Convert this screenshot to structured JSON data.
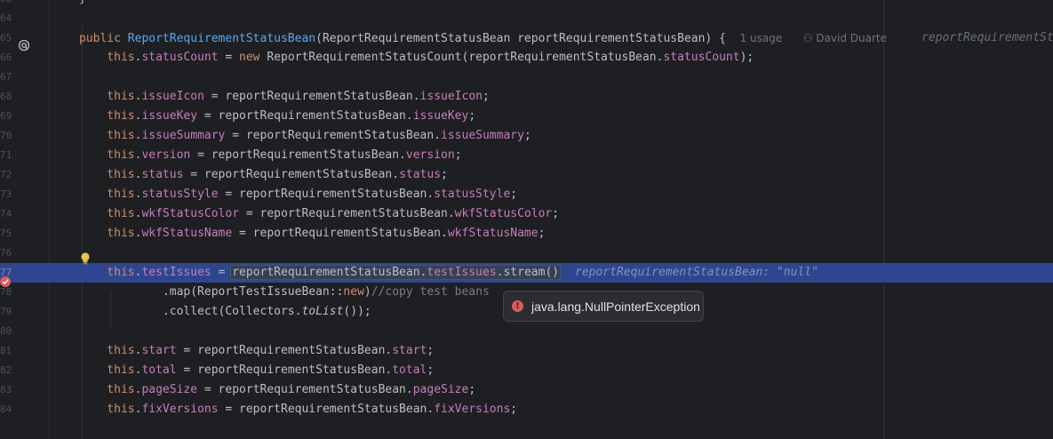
{
  "editor": {
    "lines": [
      {
        "num": "63",
        "segs": [
          {
            "t": "}",
            "c": "plain"
          }
        ]
      },
      {
        "num": "64",
        "segs": []
      },
      {
        "num": "65",
        "segs": [
          {
            "t": "public ",
            "c": "kw"
          },
          {
            "t": "ReportRequirementStatusBean",
            "c": "fn"
          },
          {
            "t": "(ReportRequirementStatusBean reportRequirementStatusBean) {  ",
            "c": "plain"
          },
          {
            "t": "1 usage",
            "c": "hint"
          },
          {
            "t": "   ",
            "c": "plain"
          },
          {
            "t": "⚇ David Duarte",
            "c": "hint"
          }
        ],
        "far_hint": "reportRequirementSt"
      },
      {
        "num": "66",
        "segs": [
          {
            "t": "    this",
            "c": "kw"
          },
          {
            "t": ".",
            "c": "plain"
          },
          {
            "t": "statusCount",
            "c": "fld"
          },
          {
            "t": " = ",
            "c": "plain"
          },
          {
            "t": "new ",
            "c": "kw"
          },
          {
            "t": "ReportRequirementStatusCount(reportRequirementStatusBean.",
            "c": "plain"
          },
          {
            "t": "statusCount",
            "c": "fld"
          },
          {
            "t": ");",
            "c": "plain"
          }
        ]
      },
      {
        "num": "67",
        "segs": []
      },
      {
        "num": "68",
        "segs": [
          {
            "t": "    this",
            "c": "kw"
          },
          {
            "t": ".",
            "c": "plain"
          },
          {
            "t": "issueIcon",
            "c": "fld"
          },
          {
            "t": " = reportRequirementStatusBean.",
            "c": "plain"
          },
          {
            "t": "issueIcon",
            "c": "fld"
          },
          {
            "t": ";",
            "c": "plain"
          }
        ]
      },
      {
        "num": "69",
        "segs": [
          {
            "t": "    this",
            "c": "kw"
          },
          {
            "t": ".",
            "c": "plain"
          },
          {
            "t": "issueKey",
            "c": "fld"
          },
          {
            "t": " = reportRequirementStatusBean.",
            "c": "plain"
          },
          {
            "t": "issueKey",
            "c": "fld"
          },
          {
            "t": ";",
            "c": "plain"
          }
        ]
      },
      {
        "num": "70",
        "segs": [
          {
            "t": "    this",
            "c": "kw"
          },
          {
            "t": ".",
            "c": "plain"
          },
          {
            "t": "issueSummary",
            "c": "fld"
          },
          {
            "t": " = reportRequirementStatusBean.",
            "c": "plain"
          },
          {
            "t": "issueSummary",
            "c": "fld"
          },
          {
            "t": ";",
            "c": "plain"
          }
        ]
      },
      {
        "num": "71",
        "segs": [
          {
            "t": "    this",
            "c": "kw"
          },
          {
            "t": ".",
            "c": "plain"
          },
          {
            "t": "version",
            "c": "fld"
          },
          {
            "t": " = reportRequirementStatusBean.",
            "c": "plain"
          },
          {
            "t": "version",
            "c": "fld"
          },
          {
            "t": ";",
            "c": "plain"
          }
        ]
      },
      {
        "num": "72",
        "segs": [
          {
            "t": "    this",
            "c": "kw"
          },
          {
            "t": ".",
            "c": "plain"
          },
          {
            "t": "status",
            "c": "fld"
          },
          {
            "t": " = reportRequirementStatusBean.",
            "c": "plain"
          },
          {
            "t": "status",
            "c": "fld"
          },
          {
            "t": ";",
            "c": "plain"
          }
        ]
      },
      {
        "num": "73",
        "segs": [
          {
            "t": "    this",
            "c": "kw"
          },
          {
            "t": ".",
            "c": "plain"
          },
          {
            "t": "statusStyle",
            "c": "fld"
          },
          {
            "t": " = reportRequirementStatusBean.",
            "c": "plain"
          },
          {
            "t": "statusStyle",
            "c": "fld"
          },
          {
            "t": ";",
            "c": "plain"
          }
        ]
      },
      {
        "num": "74",
        "segs": [
          {
            "t": "    this",
            "c": "kw"
          },
          {
            "t": ".",
            "c": "plain"
          },
          {
            "t": "wkfStatusColor",
            "c": "fld"
          },
          {
            "t": " = reportRequirementStatusBean.",
            "c": "plain"
          },
          {
            "t": "wkfStatusColor",
            "c": "fld"
          },
          {
            "t": ";",
            "c": "plain"
          }
        ]
      },
      {
        "num": "75",
        "segs": [
          {
            "t": "    this",
            "c": "kw"
          },
          {
            "t": ".",
            "c": "plain"
          },
          {
            "t": "wkfStatusName",
            "c": "fld"
          },
          {
            "t": " = reportRequirementStatusBean.",
            "c": "plain"
          },
          {
            "t": "wkfStatusName",
            "c": "fld"
          },
          {
            "t": ";",
            "c": "plain"
          }
        ]
      },
      {
        "num": "76",
        "segs": []
      },
      {
        "num": "77",
        "exec": true,
        "segs": [
          {
            "t": "    this",
            "c": "kw"
          },
          {
            "t": ".",
            "c": "plain"
          },
          {
            "t": "testIssues",
            "c": "fld"
          },
          {
            "t": " = ",
            "c": "plain"
          },
          {
            "t": "reportRequirementStatusBean.",
            "c": "plain sel"
          },
          {
            "t": "testIssues",
            "c": "fld sel"
          },
          {
            "t": ".stream()",
            "c": "plain sel"
          }
        ],
        "inline_value": "reportRequirementStatusBean: \"null\""
      },
      {
        "num": "78",
        "segs": [
          {
            "t": "            .map(ReportTestIssueBean::",
            "c": "plain"
          },
          {
            "t": "new",
            "c": "kw"
          },
          {
            "t": ")",
            "c": "plain"
          },
          {
            "t": "//copy test beans",
            "c": "cmt"
          }
        ]
      },
      {
        "num": "79",
        "segs": [
          {
            "t": "            .collect(Collectors.",
            "c": "plain"
          },
          {
            "t": "toList",
            "c": "plain it"
          },
          {
            "t": "());",
            "c": "plain"
          }
        ]
      },
      {
        "num": "80",
        "segs": []
      },
      {
        "num": "81",
        "segs": [
          {
            "t": "    this",
            "c": "kw"
          },
          {
            "t": ".",
            "c": "plain"
          },
          {
            "t": "start",
            "c": "fld"
          },
          {
            "t": " = reportRequirementStatusBean.",
            "c": "plain"
          },
          {
            "t": "start",
            "c": "fld"
          },
          {
            "t": ";",
            "c": "plain"
          }
        ]
      },
      {
        "num": "82",
        "segs": [
          {
            "t": "    this",
            "c": "kw"
          },
          {
            "t": ".",
            "c": "plain"
          },
          {
            "t": "total",
            "c": "fld"
          },
          {
            "t": " = reportRequirementStatusBean.",
            "c": "plain"
          },
          {
            "t": "total",
            "c": "fld"
          },
          {
            "t": ";",
            "c": "plain"
          }
        ]
      },
      {
        "num": "83",
        "segs": [
          {
            "t": "    this",
            "c": "kw"
          },
          {
            "t": ".",
            "c": "plain"
          },
          {
            "t": "pageSize",
            "c": "fld"
          },
          {
            "t": " = reportRequirementStatusBean.",
            "c": "plain"
          },
          {
            "t": "pageSize",
            "c": "fld"
          },
          {
            "t": ";",
            "c": "plain"
          }
        ]
      },
      {
        "num": "84",
        "segs": [
          {
            "t": "    this",
            "c": "kw"
          },
          {
            "t": ".",
            "c": "plain"
          },
          {
            "t": "fixVersions",
            "c": "fld"
          },
          {
            "t": " = reportRequirementStatusBean.",
            "c": "plain"
          },
          {
            "t": "fixVersions",
            "c": "fld"
          },
          {
            "t": ";",
            "c": "plain"
          }
        ]
      }
    ]
  },
  "gutter_icons": {
    "line65": "implementation-marker-icon",
    "line76": "lightbulb-icon",
    "line77": "breakpoint-icon"
  },
  "tooltip": {
    "message": "java.lang.NullPointerException",
    "icon": "error-icon"
  },
  "colors": {
    "background": "#1e1f22",
    "execution_line": "#2e4690",
    "keyword": "#cf8e6d",
    "field": "#c77dbb",
    "method_decl": "#56a8f5",
    "error": "#db5c5c"
  }
}
